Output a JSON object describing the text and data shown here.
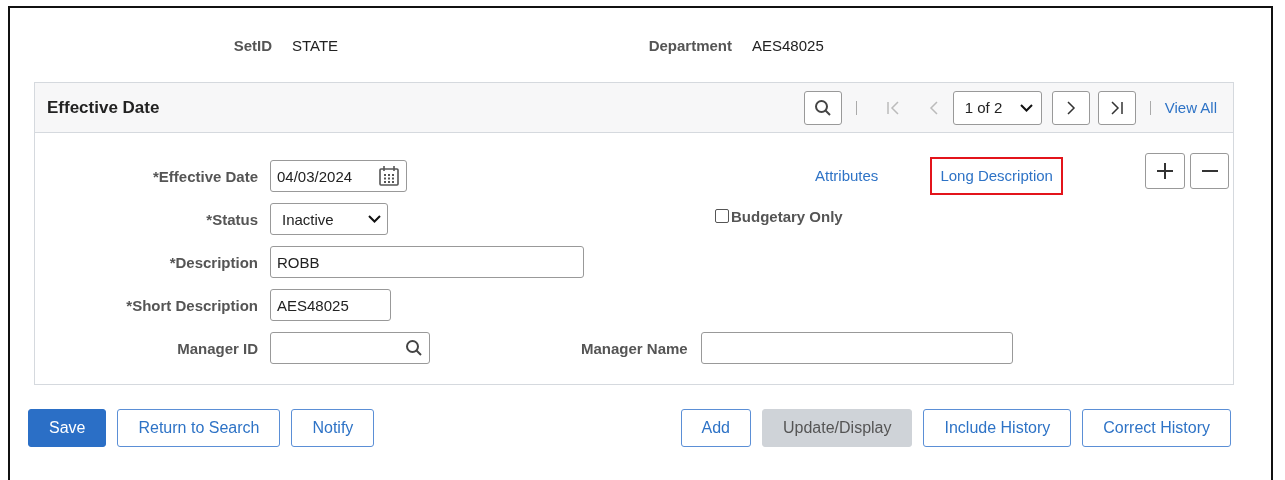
{
  "header_fields": [
    {
      "label": "SetID",
      "value": "STATE"
    },
    {
      "label": "Department",
      "value": "AES48025"
    }
  ],
  "panel": {
    "title": "Effective Date",
    "pager": {
      "page": "1 of 2",
      "first_disabled": true,
      "prev_disabled": true,
      "next_disabled": false,
      "last_disabled": false,
      "view_all": "View All"
    },
    "fields": [
      {
        "label": "*Effective Date",
        "kind": "date",
        "value": "04/03/2024"
      },
      {
        "label": "*Status",
        "kind": "select",
        "value": "Inactive"
      },
      {
        "label": "*Description",
        "kind": "text",
        "value": "ROBB"
      },
      {
        "label": "*Short Description",
        "kind": "short",
        "value": "AES48025"
      },
      {
        "label": "Manager ID",
        "kind": "lookup"
      }
    ],
    "manager_name": {
      "label": "Manager Name"
    },
    "links": [
      {
        "label": "Attributes",
        "highlighted": false
      },
      {
        "label": "Long Description",
        "highlighted": true
      }
    ],
    "checkbox": {
      "label": "Budgetary Only",
      "checked": false
    }
  },
  "buttons_left": [
    {
      "label": "Save",
      "kind": "primary",
      "disabled": false
    },
    {
      "label": "Return to Search",
      "kind": "secondary",
      "disabled": false
    },
    {
      "label": "Notify",
      "kind": "secondary",
      "disabled": false
    }
  ],
  "buttons_right": [
    {
      "label": "Add",
      "disabled": false
    },
    {
      "label": "Update/Display",
      "disabled": true
    },
    {
      "label": "Include History",
      "disabled": false
    },
    {
      "label": "Correct History",
      "disabled": false
    }
  ]
}
